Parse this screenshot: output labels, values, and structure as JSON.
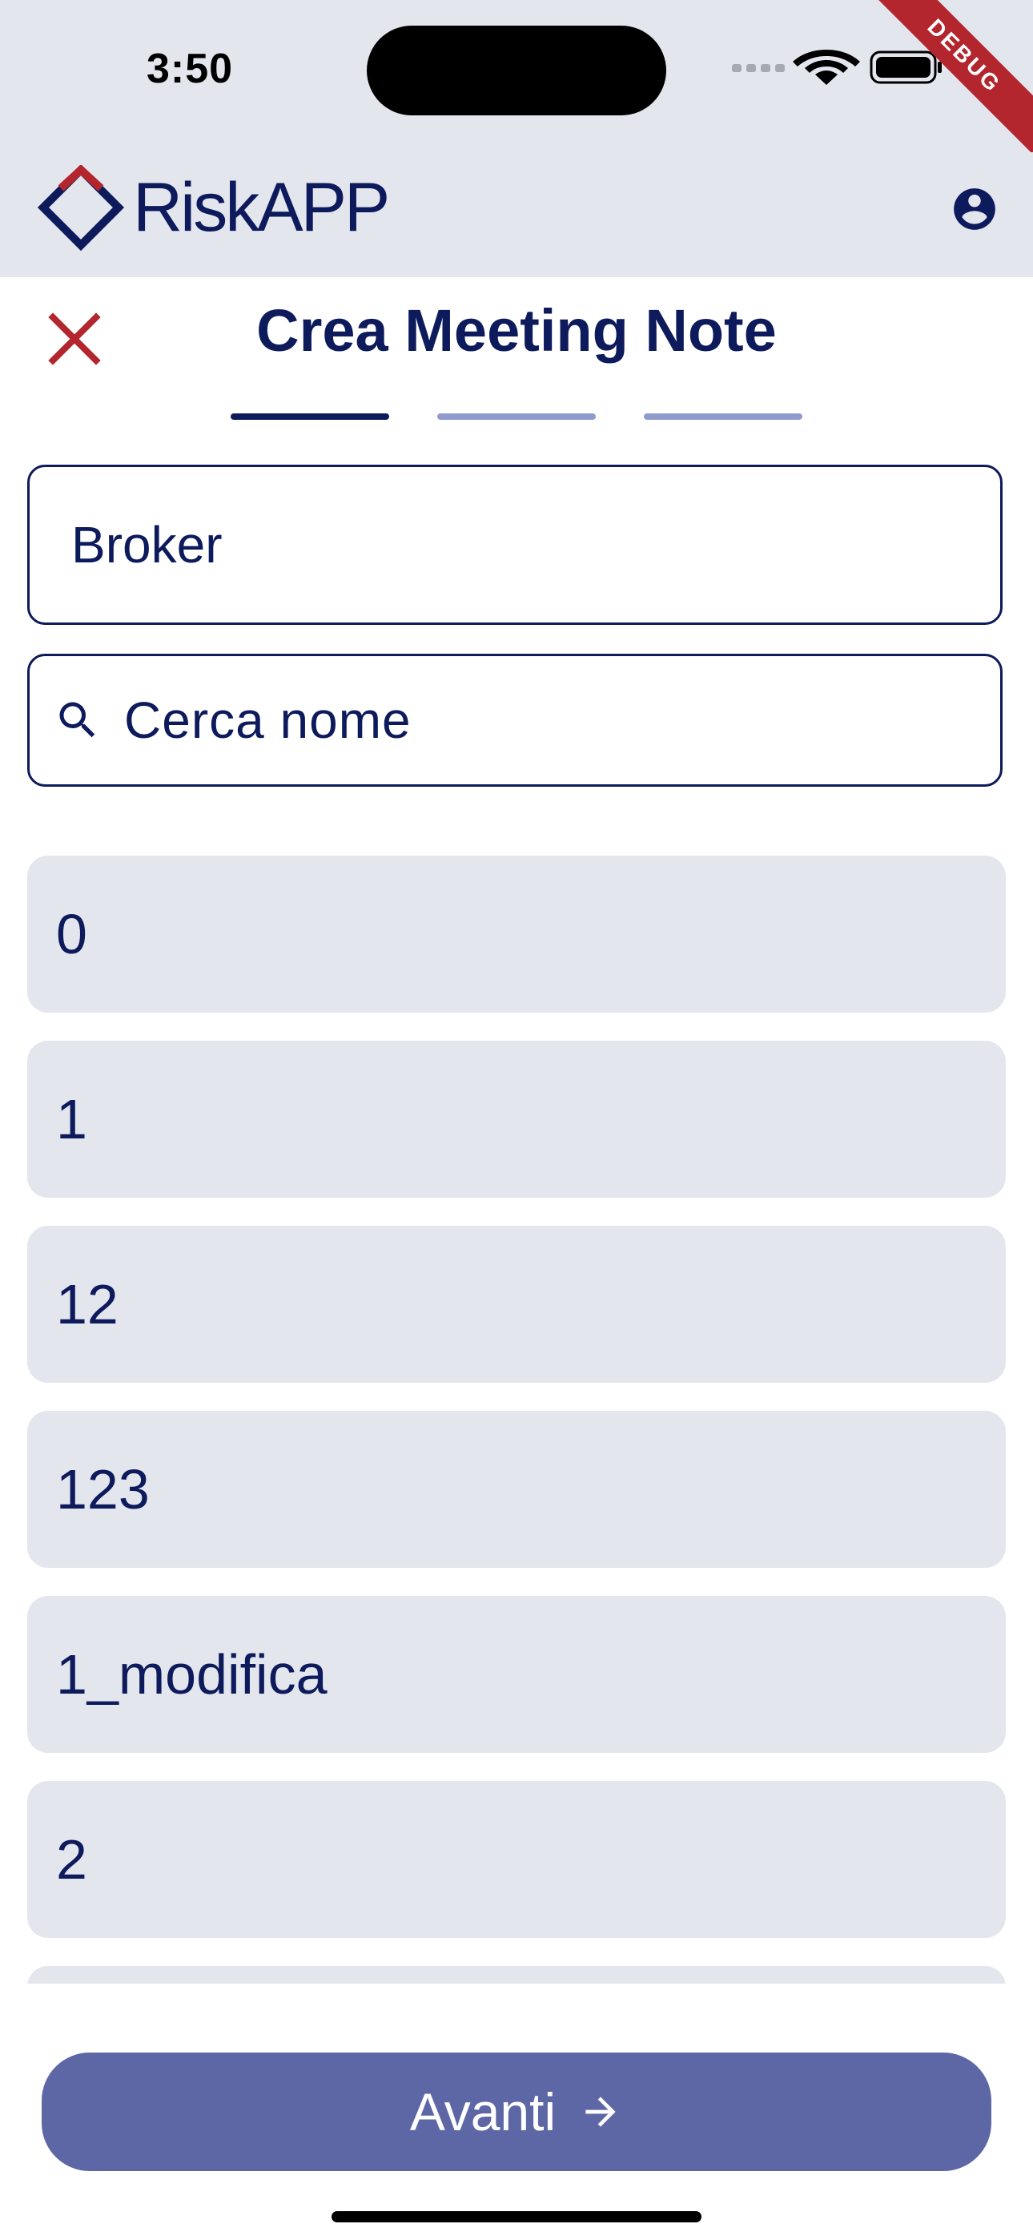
{
  "status_bar": {
    "time": "3:50",
    "debug_label": "DEBUG"
  },
  "app_bar": {
    "logo_text": "RiskAPP",
    "profile_icon": "account-circle-icon"
  },
  "header": {
    "title": "Crea Meeting Note",
    "close_icon": "close-icon",
    "steps_total": 3,
    "current_step": 1
  },
  "form": {
    "broker_value": "Broker",
    "search_placeholder": "Cerca nome"
  },
  "list": {
    "items": [
      "0",
      "1",
      "12",
      "123",
      "1_modifica",
      "2"
    ]
  },
  "footer": {
    "next_label": "Avanti",
    "next_icon": "arrow-right-icon"
  },
  "colors": {
    "primary": "#0d1a5c",
    "accent_red": "#b3262e",
    "surface": "#e4e6ee",
    "button": "#5d67a6",
    "step_inactive": "#8f9bcd"
  }
}
